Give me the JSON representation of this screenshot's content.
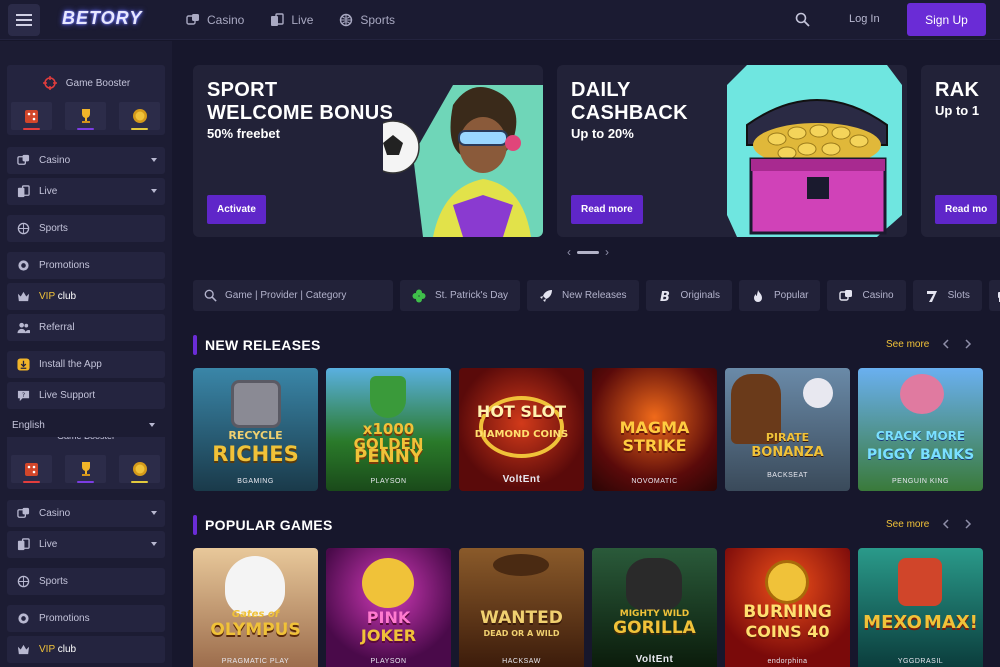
{
  "header": {
    "logo": "BETORY",
    "nav": [
      {
        "label": "Casino",
        "icon": "casino-dice-icon"
      },
      {
        "label": "Live",
        "icon": "live-cards-icon"
      },
      {
        "label": "Sports",
        "icon": "sports-ball-icon"
      }
    ],
    "login": "Log In",
    "signup": "Sign Up"
  },
  "sidebar": {
    "game_booster": "Game Booster",
    "booster_tiles": [
      {
        "icon": "dice-icon",
        "bar_color": "#e23d3d"
      },
      {
        "icon": "trophy-icon",
        "bar_color": "#7b3de2"
      },
      {
        "icon": "coin-icon",
        "bar_color": "#e2c93d"
      }
    ],
    "items": [
      {
        "label": "Casino",
        "icon": "casino-dice-icon",
        "dropdown": true
      },
      {
        "label": "Live",
        "icon": "live-cards-icon",
        "dropdown": true
      },
      {
        "label": "Sports",
        "icon": "sports-ball-icon"
      },
      {
        "label": "Promotions",
        "icon": "promotions-gift-icon"
      },
      {
        "label_vip": "VIP",
        "label_club": "club",
        "icon": "crown-icon"
      },
      {
        "label": "Referral",
        "icon": "referral-users-icon"
      },
      {
        "label": "Install the App",
        "icon": "install-download-icon"
      },
      {
        "label": "Live Support",
        "icon": "support-chat-icon"
      }
    ],
    "language": "English"
  },
  "banners": [
    {
      "title_line1": "SPORT",
      "title_line2": "WELCOME BONUS",
      "subtitle": "50% freebet",
      "button": "Activate"
    },
    {
      "title_line1": "DAILY",
      "title_line2": "CASHBACK",
      "subtitle": "Up to 20%",
      "button": "Read more"
    },
    {
      "title_line1": "RAK",
      "subtitle": "Up to 1",
      "button": "Read mo"
    }
  ],
  "filters": {
    "search_placeholder": "Game | Provider | Category",
    "chips": [
      {
        "label": "St. Patrick's Day",
        "icon": "clover-icon"
      },
      {
        "label": "New Releases",
        "icon": "rocket-icon"
      },
      {
        "label": "Originals",
        "icon": "originals-b-icon"
      },
      {
        "label": "Popular",
        "icon": "fire-icon"
      },
      {
        "label": "Casino",
        "icon": "casino-dice-icon"
      },
      {
        "label": "Slots",
        "icon": "slots-seven-icon"
      },
      {
        "label": "",
        "icon": "table-games-icon"
      }
    ]
  },
  "sections": {
    "new_releases": {
      "title": "NEW RELEASES",
      "see_more": "See more",
      "games": [
        {
          "title_a": "RECYCLE",
          "title_b": "RICHES",
          "provider": "BGAMING",
          "bg": "#2a6d8c"
        },
        {
          "title_a": "x1000 GOLDEN",
          "title_b": "PENNY",
          "provider": "PLAYSON",
          "bg": "#3a7a2a"
        },
        {
          "title_a": "HOT SLOT",
          "title_b": "DIAMOND COINS",
          "provider": "VoltEnt",
          "bg": "#7a1414"
        },
        {
          "title_a": "MAGMA",
          "title_b": "STRIKE",
          "provider": "NOVOMATIC",
          "bg": "#5a1410"
        },
        {
          "title_a": "PIRATE",
          "title_b": "BONANZA",
          "provider": "BACKSEAT",
          "bg": "#3a4a5a"
        },
        {
          "title_a": "CRACK MORE",
          "title_b": "PIGGY BANKS",
          "provider": "PENGUIN KING",
          "bg": "#3b6fb0"
        }
      ]
    },
    "popular_games": {
      "title": "POPULAR GAMES",
      "see_more": "See more",
      "games": [
        {
          "title_a": "Gates of",
          "title_b": "OLYMPUS",
          "provider": "PRAGMATIC PLAY",
          "bg": "#b88a5a"
        },
        {
          "title_a": "PINK",
          "title_b": "JOKER",
          "provider": "PLAYSON",
          "bg": "#7a1a6a"
        },
        {
          "title_a": "WANTED",
          "title_b": "DEAD OR A WILD",
          "provider": "HACKSAW",
          "bg": "#5a3a1a"
        },
        {
          "title_a": "MIGHTY WILD",
          "title_b": "GORILLA",
          "provider": "VoltEnt",
          "bg": "#1a3a22"
        },
        {
          "title_a": "BURNING",
          "title_b": "COINS 40",
          "provider": "endorphina",
          "bg": "#a81a10"
        },
        {
          "title_a": "MEXO",
          "title_b": "MAX!",
          "provider": "YGGDRASIL",
          "bg": "#1a6a5a"
        }
      ]
    }
  }
}
